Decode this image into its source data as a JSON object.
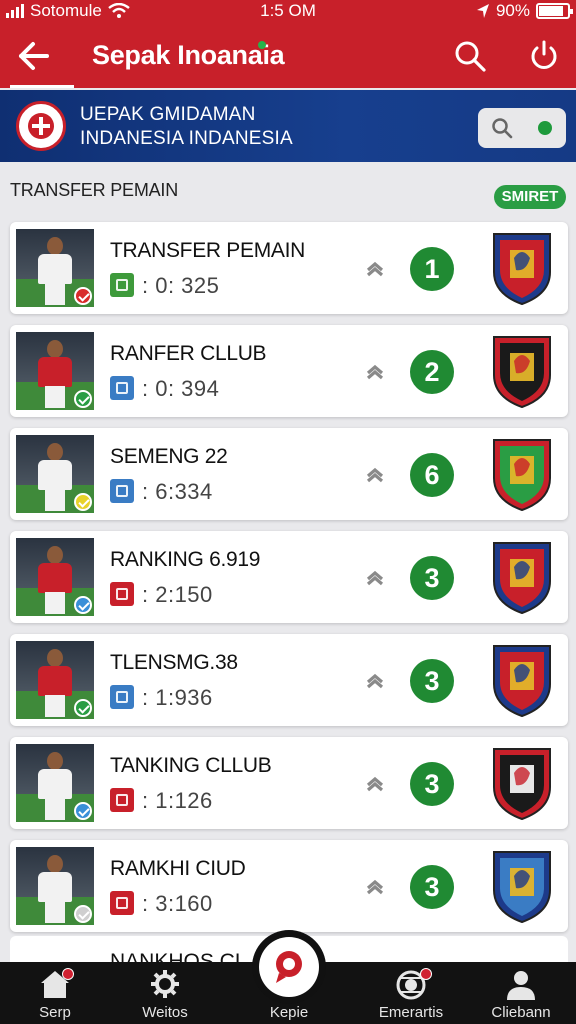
{
  "status": {
    "carrier": "Sotomule",
    "time": "1:5 OM",
    "battery": "90%"
  },
  "appbar": {
    "title": "Sepak Inoanaia"
  },
  "banner": {
    "line1": "UEPAK GMIDAMAN",
    "line2": "INDANESIA INDANESIA"
  },
  "section": {
    "title": "TRANSFER PEMAIN",
    "badge": "SMIRET"
  },
  "items": [
    {
      "title": "TRANSFER PEMAIN",
      "value": ": 0: 325",
      "rank": "1",
      "shirt": "#f2f2f2",
      "check": "#d92b2b",
      "mini": "#3e9a3b",
      "crest": [
        "#1d3a8a",
        "#c8202a",
        "#e3b52a"
      ]
    },
    {
      "title": "RANFER CLLUB",
      "value": ": 0: 394",
      "rank": "2",
      "shirt": "#c8202a",
      "check": "#2a9d44",
      "mini": "#3a7cc4",
      "crest": [
        "#c8202a",
        "#1a1a1a",
        "#e3b52a"
      ]
    },
    {
      "title": "SEMENG 22",
      "value": ": 6:334",
      "rank": "6",
      "shirt": "#f2f2f2",
      "check": "#e8d22a",
      "mini": "#3a7cc4",
      "crest": [
        "#c8202a",
        "#2a9d44",
        "#e3b52a"
      ]
    },
    {
      "title": "RANKING 6.919",
      "value": ": 2:150",
      "rank": "3",
      "shirt": "#c8202a",
      "check": "#3a8fd8",
      "mini": "#c8202a",
      "crest": [
        "#1d3a8a",
        "#c8202a",
        "#e3b52a"
      ]
    },
    {
      "title": "TLENSMG.38",
      "value": ": 1:936",
      "rank": "3",
      "shirt": "#c8202a",
      "check": "#2a9d44",
      "mini": "#3a7cc4",
      "crest": [
        "#1d3a8a",
        "#c8202a",
        "#e3b52a"
      ]
    },
    {
      "title": "TANKING CLLUB",
      "value": ": 1:126",
      "rank": "3",
      "shirt": "#f2f2f2",
      "check": "#3a8fd8",
      "mini": "#c8202a",
      "crest": [
        "#c8202a",
        "#1a1a1a",
        "#f2f2f2"
      ]
    },
    {
      "title": "RAMKHI CIUD",
      "value": ": 3:160",
      "rank": "3",
      "shirt": "#f2f2f2",
      "check": "#cfcfcf",
      "mini": "#c8202a",
      "crest": [
        "#1d3a8a",
        "#3a7cc4",
        "#e3b52a"
      ]
    }
  ],
  "peek_item": {
    "title": "NANKHOS CL"
  },
  "nav": [
    {
      "label": "Serp",
      "icon": "home-icon"
    },
    {
      "label": "Weitos",
      "icon": "gear-icon"
    },
    {
      "label": "Kepie",
      "icon": "pin-icon"
    },
    {
      "label": "Emerartis",
      "icon": "ball-icon"
    },
    {
      "label": "Cliebann",
      "icon": "user-icon"
    }
  ],
  "colors": {
    "primary": "#c8202a",
    "banner": "#173f8e",
    "accent_green": "#208a33",
    "nav_bg": "#121212"
  }
}
